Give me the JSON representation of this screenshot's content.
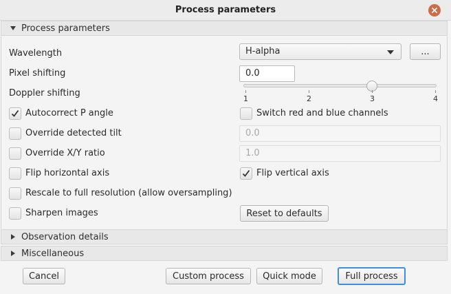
{
  "window": {
    "title": "Process parameters"
  },
  "sections": {
    "process": "Process parameters",
    "observation": "Observation details",
    "misc": "Miscellaneous"
  },
  "wavelength": {
    "label": "Wavelength",
    "selected": "H-alpha",
    "more_button": "..."
  },
  "pixel_shifting": {
    "label": "Pixel shifting",
    "value": "0.0"
  },
  "doppler_shifting": {
    "label": "Doppler shifting",
    "ticks": [
      "1",
      "2",
      "3",
      "4"
    ],
    "value": 3.0
  },
  "autocorrect": {
    "label": "Autocorrect P angle",
    "checked": true
  },
  "switch_channels": {
    "label": "Switch red and blue channels",
    "checked": false
  },
  "override_tilt": {
    "label": "Override detected tilt",
    "checked": false,
    "value": "0.0"
  },
  "override_ratio": {
    "label": "Override X/Y ratio",
    "checked": false,
    "value": "1.0"
  },
  "flip_h": {
    "label": "Flip horizontal axis",
    "checked": false
  },
  "flip_v": {
    "label": "Flip vertical axis",
    "checked": true
  },
  "rescale": {
    "label": "Rescale to full resolution (allow oversampling)",
    "checked": false
  },
  "sharpen": {
    "label": "Sharpen images",
    "checked": false
  },
  "reset_button": "Reset to defaults",
  "footer": {
    "cancel": "Cancel",
    "custom": "Custom process",
    "quick": "Quick mode",
    "full": "Full process"
  }
}
